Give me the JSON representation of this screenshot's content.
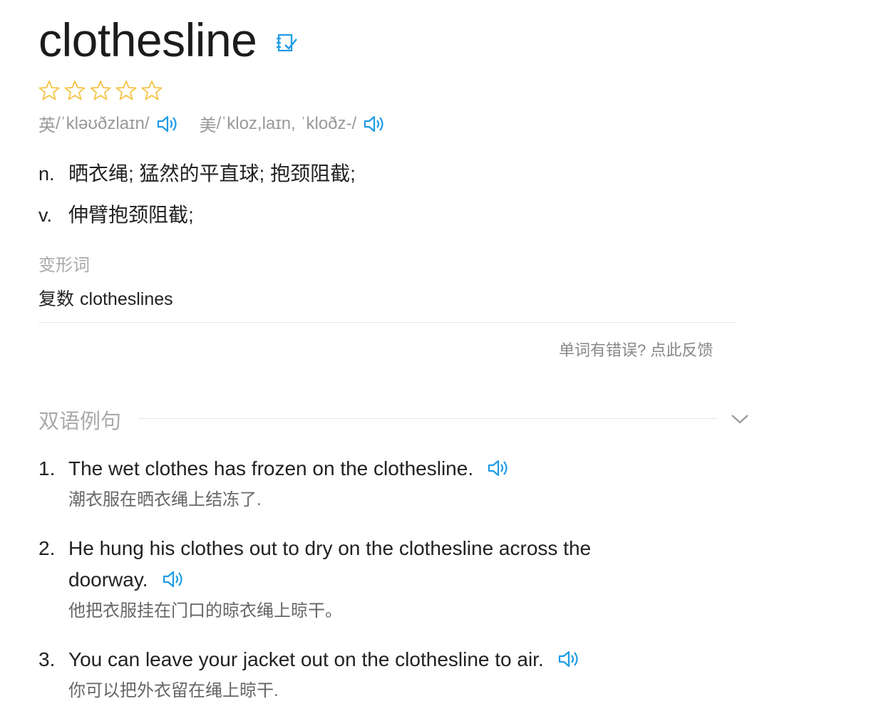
{
  "header": {
    "word": "clothesline"
  },
  "rating": {
    "stars": 5,
    "filled": 0,
    "color": "#f5c244"
  },
  "phonetic": {
    "uk_label": "英",
    "uk": "/ˈkləʊðzlaɪn/",
    "us_label": "美",
    "us": "/ˈkloz,laɪn, ˈkloðz-/",
    "icon": "speaker-icon",
    "icon_color": "#1e9be6"
  },
  "definitions": [
    {
      "pos": "n.",
      "meaning": "晒衣绳; 猛然的平直球; 抱颈阻截;"
    },
    {
      "pos": "v.",
      "meaning": "伸臂抱颈阻截;"
    }
  ],
  "inflections": {
    "label": "变形词",
    "type": "复数",
    "form": "clotheslines"
  },
  "feedback": {
    "text": "单词有错误? 点此反馈"
  },
  "bilingual": {
    "title": "双语例句",
    "examples": [
      {
        "num": "1.",
        "en": "The wet clothes has frozen on the clothesline.",
        "zh": "潮衣服在晒衣绳上结冻了."
      },
      {
        "num": "2.",
        "en": "He hung his clothes out to dry on the clothesline across the doorway.",
        "zh": "他把衣服挂在门口的晾衣绳上晾干。"
      },
      {
        "num": "3.",
        "en": "You can leave your jacket out on the clothesline to air.",
        "zh": "你可以把外衣留在绳上晾干."
      }
    ]
  }
}
